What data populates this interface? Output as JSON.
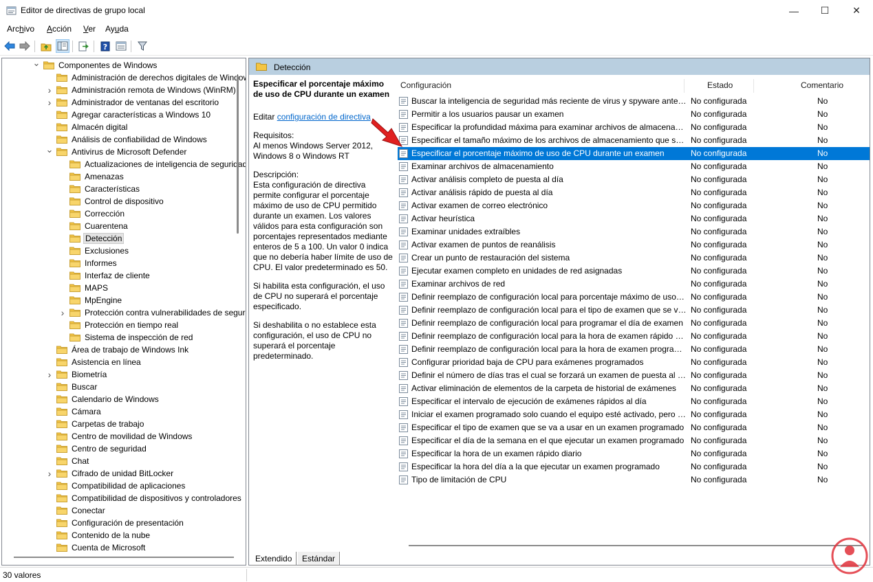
{
  "window": {
    "title": "Editor de directivas de grupo local",
    "minimize": "—",
    "maximize": "☐",
    "close": "✕"
  },
  "menu": [
    {
      "pre": "Arc",
      "acc": "h",
      "post": "ivo"
    },
    {
      "pre": "",
      "acc": "A",
      "post": "cción"
    },
    {
      "pre": "",
      "acc": "V",
      "post": "er"
    },
    {
      "pre": "Ay",
      "acc": "u",
      "post": "da"
    }
  ],
  "toolbar": [
    "back-icon",
    "forward-icon",
    "up-folder-icon",
    "show-hide-tree-icon",
    "export-list-icon",
    "help-icon",
    "properties-icon",
    "filter-icon"
  ],
  "tree": [
    {
      "label": "Componentes de Windows",
      "level": 0,
      "expander": "expanded"
    },
    {
      "label": "Administración de derechos digitales de Windows",
      "level": 1,
      "expander": "none"
    },
    {
      "label": "Administración remota de Windows (WinRM)",
      "level": 1,
      "expander": "collapsed"
    },
    {
      "label": "Administrador de ventanas del escritorio",
      "level": 1,
      "expander": "collapsed"
    },
    {
      "label": "Agregar características a Windows 10",
      "level": 1,
      "expander": "none"
    },
    {
      "label": "Almacén digital",
      "level": 1,
      "expander": "none"
    },
    {
      "label": "Análisis de confiabilidad de Windows",
      "level": 1,
      "expander": "none"
    },
    {
      "label": "Antivirus de Microsoft Defender",
      "level": 1,
      "expander": "expanded"
    },
    {
      "label": "Actualizaciones de inteligencia de seguridad",
      "level": 2,
      "expander": "none"
    },
    {
      "label": "Amenazas",
      "level": 2,
      "expander": "none"
    },
    {
      "label": "Características",
      "level": 2,
      "expander": "none"
    },
    {
      "label": "Control de dispositivo",
      "level": 2,
      "expander": "none"
    },
    {
      "label": "Corrección",
      "level": 2,
      "expander": "none"
    },
    {
      "label": "Cuarentena",
      "level": 2,
      "expander": "none"
    },
    {
      "label": "Detección",
      "level": 2,
      "expander": "none",
      "selected": true
    },
    {
      "label": "Exclusiones",
      "level": 2,
      "expander": "none"
    },
    {
      "label": "Informes",
      "level": 2,
      "expander": "none"
    },
    {
      "label": "Interfaz de cliente",
      "level": 2,
      "expander": "none"
    },
    {
      "label": "MAPS",
      "level": 2,
      "expander": "none"
    },
    {
      "label": "MpEngine",
      "level": 2,
      "expander": "none"
    },
    {
      "label": "Protección contra vulnerabilidades de seguridad",
      "level": 2,
      "expander": "collapsed"
    },
    {
      "label": "Protección en tiempo real",
      "level": 2,
      "expander": "none"
    },
    {
      "label": "Sistema de inspección de red",
      "level": 2,
      "expander": "none"
    },
    {
      "label": "Área de trabajo de Windows Ink",
      "level": 1,
      "expander": "none"
    },
    {
      "label": "Asistencia en línea",
      "level": 1,
      "expander": "none"
    },
    {
      "label": "Biometría",
      "level": 1,
      "expander": "collapsed"
    },
    {
      "label": "Buscar",
      "level": 1,
      "expander": "none"
    },
    {
      "label": "Calendario de Windows",
      "level": 1,
      "expander": "none"
    },
    {
      "label": "Cámara",
      "level": 1,
      "expander": "none"
    },
    {
      "label": "Carpetas de trabajo",
      "level": 1,
      "expander": "none"
    },
    {
      "label": "Centro de movilidad de Windows",
      "level": 1,
      "expander": "none"
    },
    {
      "label": "Centro de seguridad",
      "level": 1,
      "expander": "none"
    },
    {
      "label": "Chat",
      "level": 1,
      "expander": "none"
    },
    {
      "label": "Cifrado de unidad BitLocker",
      "level": 1,
      "expander": "collapsed"
    },
    {
      "label": "Compatibilidad de aplicaciones",
      "level": 1,
      "expander": "none"
    },
    {
      "label": "Compatibilidad de dispositivos y controladores",
      "level": 1,
      "expander": "none"
    },
    {
      "label": "Conectar",
      "level": 1,
      "expander": "none"
    },
    {
      "label": "Configuración de presentación",
      "level": 1,
      "expander": "none"
    },
    {
      "label": "Contenido de la nube",
      "level": 1,
      "expander": "none"
    },
    {
      "label": "Cuenta de Microsoft",
      "level": 1,
      "expander": "none"
    }
  ],
  "right": {
    "header_title": "Detección",
    "description": {
      "title": "Especificar el porcentaje máximo de uso de CPU durante un examen",
      "edit_prefix": "Editar ",
      "edit_link": "configuración de directiva",
      "req_label": "Requisitos:",
      "req_text": "Al menos Windows Server 2012, Windows 8 o Windows RT",
      "desc_label": "Descripción:",
      "desc_text": "Esta configuración de directiva permite configurar el porcentaje máximo de uso de CPU permitido durante un examen. Los valores válidos para esta configuración son porcentajes representados mediante enteros de 5 a 100. Un valor 0 indica que no debería haber límite de uso de CPU. El valor predeterminado es 50.",
      "p2": "Si habilita esta configuración, el uso de CPU no superará el porcentaje especificado.",
      "p3": "Si deshabilita o no establece esta configuración, el uso de CPU no superará el porcentaje predeterminado."
    },
    "columns": {
      "name": "Configuración",
      "state": "Estado",
      "comment": "Comentario"
    },
    "rows": [
      {
        "name": "Buscar la inteligencia de seguridad más reciente de virus y spyware antes de ejecutar un examen programado",
        "state": "No configurada",
        "comment": "No"
      },
      {
        "name": "Permitir a los usuarios pausar un examen",
        "state": "No configurada",
        "comment": "No"
      },
      {
        "name": "Especificar la profundidad máxima para examinar archivos de almacenamiento",
        "state": "No configurada",
        "comment": "No"
      },
      {
        "name": "Especificar el tamaño máximo de los archivos de almacenamiento que se examinarán",
        "state": "No configurada",
        "comment": "No"
      },
      {
        "name": "Especificar el porcentaje máximo de uso de CPU durante un examen",
        "state": "No configurada",
        "comment": "No",
        "selected": true
      },
      {
        "name": "Examinar archivos de almacenamiento",
        "state": "No configurada",
        "comment": "No"
      },
      {
        "name": "Activar análisis completo de puesta al día",
        "state": "No configurada",
        "comment": "No"
      },
      {
        "name": "Activar análisis rápido de puesta al día",
        "state": "No configurada",
        "comment": "No"
      },
      {
        "name": "Activar examen de correo electrónico",
        "state": "No configurada",
        "comment": "No"
      },
      {
        "name": "Activar heurística",
        "state": "No configurada",
        "comment": "No"
      },
      {
        "name": "Examinar unidades extraíbles",
        "state": "No configurada",
        "comment": "No"
      },
      {
        "name": "Activar examen de puntos de reanálisis",
        "state": "No configurada",
        "comment": "No"
      },
      {
        "name": "Crear un punto de restauración del sistema",
        "state": "No configurada",
        "comment": "No"
      },
      {
        "name": "Ejecutar examen completo en unidades de red asignadas",
        "state": "No configurada",
        "comment": "No"
      },
      {
        "name": "Examinar archivos de red",
        "state": "No configurada",
        "comment": "No"
      },
      {
        "name": "Definir reemplazo de configuración local para porcentaje máximo de uso de CPU",
        "state": "No configurada",
        "comment": "No"
      },
      {
        "name": "Definir reemplazo de configuración local para el tipo de examen que se va a usar",
        "state": "No configurada",
        "comment": "No"
      },
      {
        "name": "Definir reemplazo de configuración local para programar el día de examen",
        "state": "No configurada",
        "comment": "No"
      },
      {
        "name": "Definir reemplazo de configuración local para la hora de examen rápido programado",
        "state": "No configurada",
        "comment": "No"
      },
      {
        "name": "Definir reemplazo de configuración local para la hora de examen programado",
        "state": "No configurada",
        "comment": "No"
      },
      {
        "name": "Configurar prioridad baja de CPU para exámenes programados",
        "state": "No configurada",
        "comment": "No"
      },
      {
        "name": "Definir el número de días tras el cual se forzará un examen de puesta al día",
        "state": "No configurada",
        "comment": "No"
      },
      {
        "name": "Activar eliminación de elementos de la carpeta de historial de exámenes",
        "state": "No configurada",
        "comment": "No"
      },
      {
        "name": "Especificar el intervalo de ejecución de exámenes rápidos al día",
        "state": "No configurada",
        "comment": "No"
      },
      {
        "name": "Iniciar el examen programado solo cuando el equipo esté activado, pero no en uso",
        "state": "No configurada",
        "comment": "No"
      },
      {
        "name": "Especificar el tipo de examen que se va a usar en un examen programado",
        "state": "No configurada",
        "comment": "No"
      },
      {
        "name": "Especificar el día de la semana en el que ejecutar un examen programado",
        "state": "No configurada",
        "comment": "No"
      },
      {
        "name": "Especificar la hora de un examen rápido diario",
        "state": "No configurada",
        "comment": "No"
      },
      {
        "name": "Especificar la hora del día a la que ejecutar un examen programado",
        "state": "No configurada",
        "comment": "No"
      },
      {
        "name": "Tipo de limitación de CPU",
        "state": "No configurada",
        "comment": "No"
      }
    ]
  },
  "tabs": {
    "extended": "Extendido",
    "standard": "Estándar"
  },
  "status": {
    "text": "30 valores"
  },
  "colors": {
    "accent": "#0078d7",
    "header": "#b9cfe0",
    "folder": "#f5c542",
    "arrow": "#e02020",
    "watermark": "#e0303a"
  }
}
